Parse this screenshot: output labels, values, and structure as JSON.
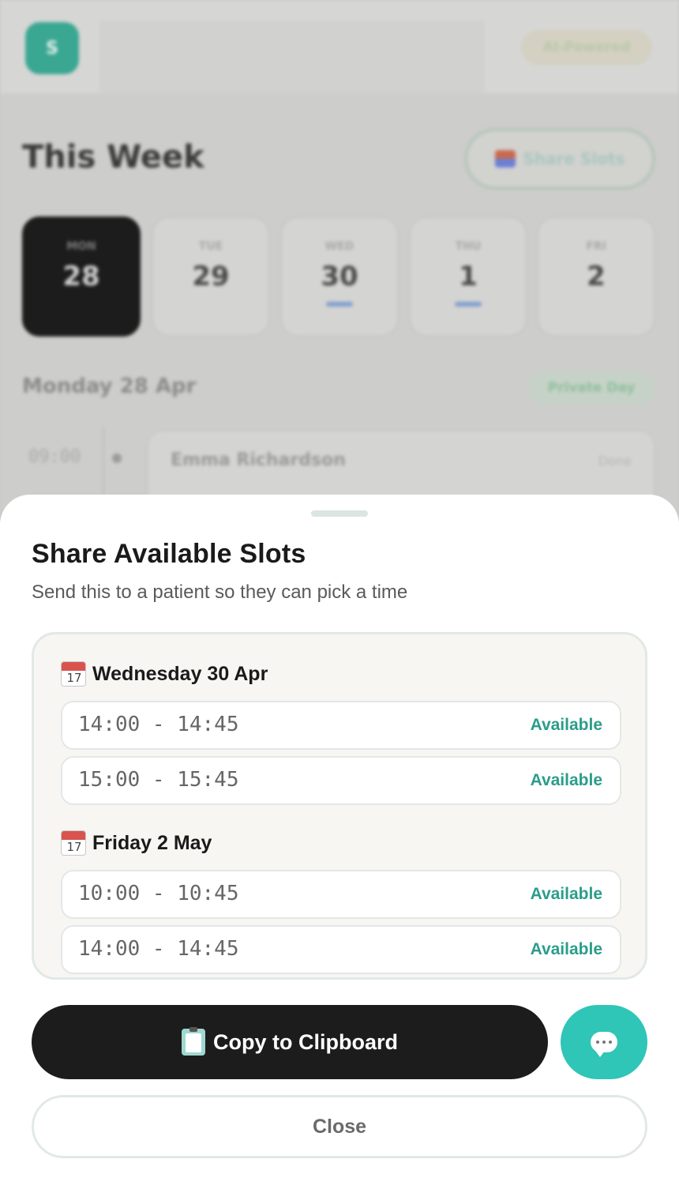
{
  "background": {
    "logo_letter": "S",
    "badge": "AI-Powered",
    "week_title": "This Week",
    "share_button": "Share Slots",
    "days": [
      {
        "name": "MON",
        "num": "28",
        "active": true
      },
      {
        "name": "TUE",
        "num": "29"
      },
      {
        "name": "WED",
        "num": "30"
      },
      {
        "name": "THU",
        "num": "1"
      },
      {
        "name": "FRI",
        "num": "2"
      }
    ],
    "date_heading": "Monday 28 Apr",
    "private_badge": "Private Day",
    "appointment": {
      "time": "09:00",
      "name": "Emma Richardson",
      "status": "Done"
    }
  },
  "sheet": {
    "title": "Share Available Slots",
    "subtitle": "Send this to a patient so they can pick a time",
    "groups": [
      {
        "label": "Wednesday 30 Apr",
        "slots": [
          {
            "time": "14:00 - 14:45",
            "status": "Available"
          },
          {
            "time": "15:00 - 15:45",
            "status": "Available"
          }
        ]
      },
      {
        "label": "Friday 2 May",
        "slots": [
          {
            "time": "10:00 - 10:45",
            "status": "Available"
          },
          {
            "time": "14:00 - 14:45",
            "status": "Available"
          }
        ]
      }
    ],
    "calendar_icon_day": "17",
    "copy_button": "Copy to Clipboard",
    "message_icon": "chat-bubble-icon",
    "close_button": "Close"
  },
  "colors": {
    "accent": "#2a9d8a",
    "message_button": "#2fc5b7",
    "primary_button": "#1c1c1c"
  }
}
